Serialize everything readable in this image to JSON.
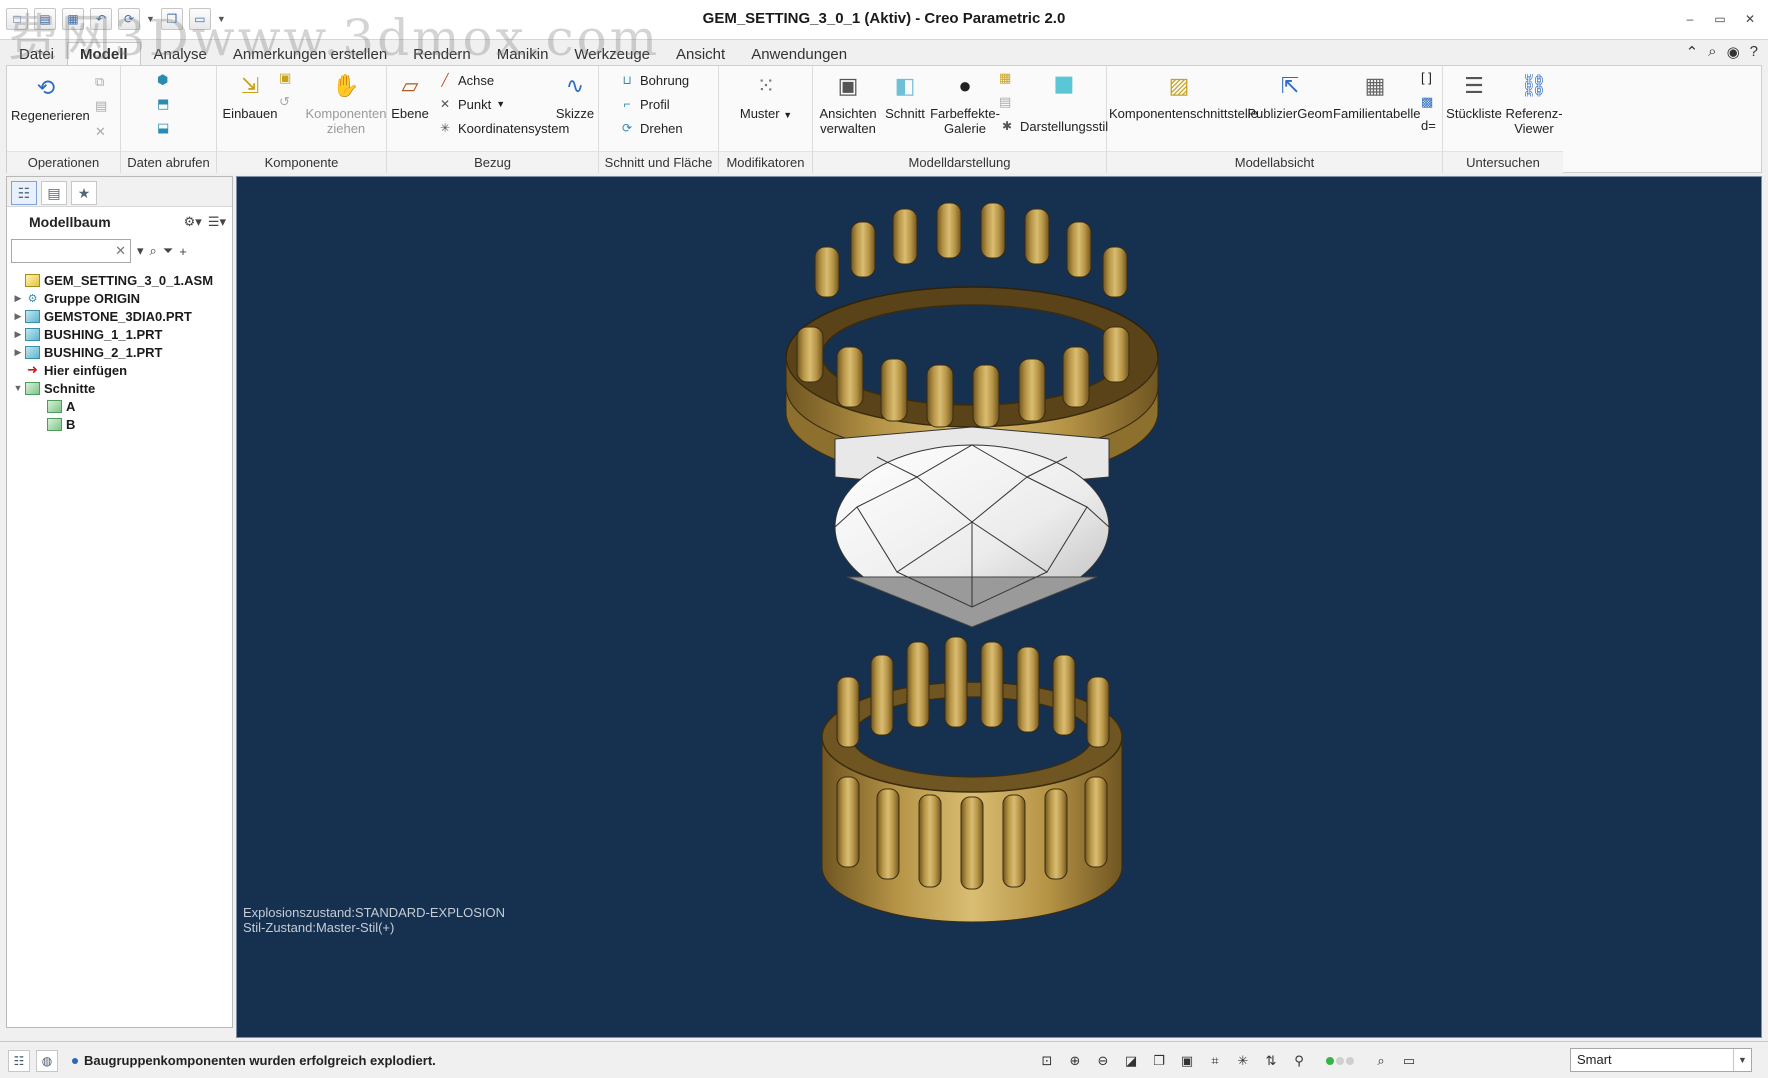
{
  "window": {
    "title": "GEM_SETTING_3_0_1 (Aktiv) - Creo Parametric 2.0",
    "watermark": "费网3Dwww.3dmox.com"
  },
  "menu": {
    "tabs": [
      "Datei",
      "Modell",
      "Analyse",
      "Anmerkungen erstellen",
      "Rendern",
      "Manikin",
      "Werkzeuge",
      "Ansicht",
      "Anwendungen"
    ],
    "active_tab": "Modell"
  },
  "ribbon": {
    "groups": {
      "operationen": "Operationen",
      "daten_abrufen": "Daten abrufen",
      "komponente": "Komponente",
      "bezug": "Bezug",
      "schnitt_und_flaeche": "Schnitt und Fläche",
      "modifikatoren": "Modifikatoren",
      "modelldarstellung": "Modelldarstellung",
      "modellabsicht": "Modellabsicht",
      "untersuchen": "Untersuchen"
    },
    "buttons": {
      "regenerieren": "Regenerieren",
      "einbauen": "Einbauen",
      "komponenten_ziehen_1": "Komponenten",
      "komponenten_ziehen_2": "ziehen",
      "ebene": "Ebene",
      "achse": "Achse",
      "punkt": "Punkt",
      "koordinatensystem": "Koordinatensystem",
      "skizze": "Skizze",
      "bohrung": "Bohrung",
      "profil": "Profil",
      "drehen": "Drehen",
      "muster": "Muster",
      "ansichten_verwalten_1": "Ansichten",
      "ansichten_verwalten_2": "verwalten",
      "schnitt": "Schnitt",
      "farbeffekte_1": "Farbeffekte-",
      "farbeffekte_2": "Galerie",
      "darstellungsstil": "Darstellungsstil",
      "komponentenschnittstelle": "Komponentenschnittstelle",
      "publiziergeom": "PublizierGeom",
      "familientabelle": "Familientabelle",
      "stueckliste": "Stückliste",
      "referenz_viewer_1": "Referenz-",
      "referenz_viewer_2": "Viewer"
    }
  },
  "left_panel": {
    "title": "Modellbaum",
    "search_placeholder": "",
    "tree": [
      {
        "label": "GEM_SETTING_3_0_1.ASM",
        "type": "asm",
        "level": 0,
        "arrow": ""
      },
      {
        "label": "Gruppe ORIGIN",
        "type": "group",
        "level": 0,
        "arrow": "▶"
      },
      {
        "label": "GEMSTONE_3DIA0.PRT",
        "type": "part",
        "level": 0,
        "arrow": "▶"
      },
      {
        "label": "BUSHING_1_1.PRT",
        "type": "part",
        "level": 0,
        "arrow": "▶"
      },
      {
        "label": "BUSHING_2_1.PRT",
        "type": "part",
        "level": 0,
        "arrow": "▶"
      },
      {
        "label": "Hier einfügen",
        "type": "insert",
        "level": 0,
        "arrow": ""
      },
      {
        "label": "Schnitte",
        "type": "sect",
        "level": 0,
        "arrow": "▼"
      },
      {
        "label": "A",
        "type": "sect",
        "level": 1,
        "arrow": ""
      },
      {
        "label": "B",
        "type": "sect",
        "level": 1,
        "arrow": ""
      }
    ]
  },
  "viewport": {
    "info_line1": "Explosionszustand:STANDARD-EXPLOSION",
    "info_line2": "Stil-Zustand:Master-Stil(+)",
    "background": "#16304f",
    "gold": "#a98a3e",
    "gem": "#f2f2f2"
  },
  "statusbar": {
    "message": "Baugruppenkomponenten wurden erfolgreich explodiert.",
    "filter_value": "Smart"
  }
}
